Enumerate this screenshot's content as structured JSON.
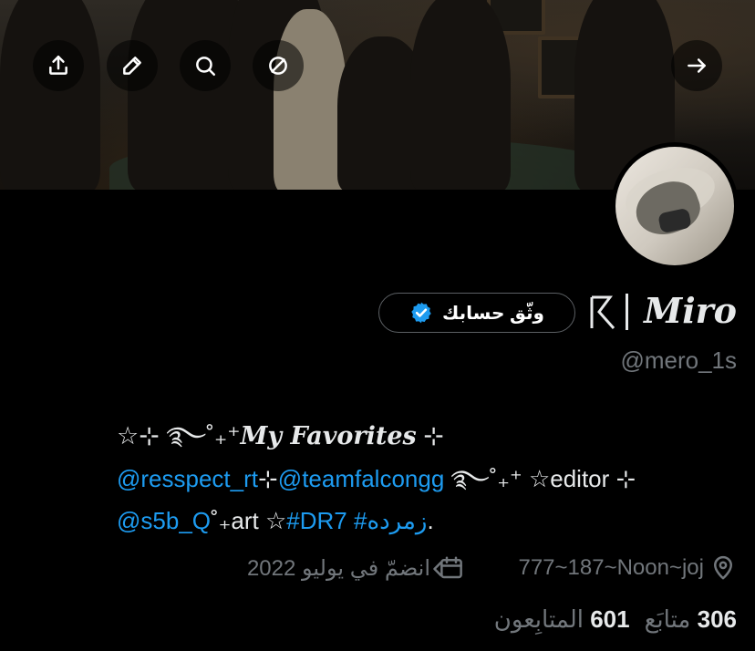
{
  "header": {
    "share_icon": "upload-icon",
    "edit_icon": "pencil-icon",
    "search_icon": "search-icon",
    "no_icon": "no-symbol-icon",
    "back_icon": "arrow-right-icon"
  },
  "profile": {
    "display_name": "Miro",
    "name_prefix": "ᖇ|",
    "handle": "@mero_1s",
    "verify_button": "وثّق حسابك",
    "bio": {
      "line1_prefix": "☆⊹ ࿐˚₊⁺",
      "line1_title": "My Favorites",
      "line1_suffix": " ⊹",
      "mention1": "@resspect_rt",
      "sep1": "⊹",
      "mention2": "@teamfalcongg",
      "after_mention2": " ࿐˚₊⁺ ☆editor ⊹",
      "mention3": "@s5b_Q",
      "after_mention3": "˚₊art ☆",
      "hashtag1": "#DR7",
      "hashtag2": "#زمرده",
      "end": "."
    },
    "location": "777~187~Noon~joj",
    "joined": "انضمّ في يوليو 2022",
    "following_count": "306",
    "following_label": "متابَع",
    "followers_count": "601",
    "followers_label": "المتابِعون"
  },
  "colors": {
    "accent": "#1d9bf0",
    "muted": "#71767b",
    "background": "#000000"
  }
}
